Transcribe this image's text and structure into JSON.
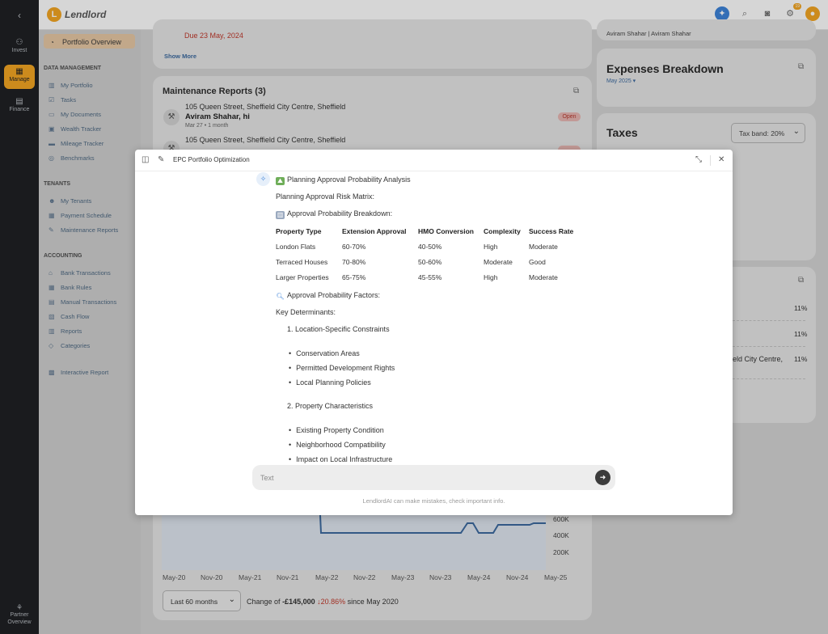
{
  "app": {
    "logo_text": "Lendlord",
    "logo_letter": "L"
  },
  "rail": {
    "items": [
      {
        "label": "Invest",
        "icon": "network-icon"
      },
      {
        "label": "Manage",
        "icon": "grid-icon"
      },
      {
        "label": "Finance",
        "icon": "document-icon"
      }
    ],
    "bottom_label_1": "Partner",
    "bottom_label_2": "Overview"
  },
  "topbar": {
    "notification_count": "19"
  },
  "sidebar": {
    "active_item": "Portfolio Overview",
    "sections": {
      "data_management": "DATA MANAGEMENT",
      "tenants": "TENANTS",
      "accounting": "ACCOUNTING"
    },
    "items": [
      "My Portfolio",
      "Tasks",
      "My Documents",
      "Wealth Tracker",
      "Mileage Tracker",
      "Benchmarks",
      "My Tenants",
      "Payment Schedule",
      "Maintenance Reports",
      "Bank Transactions",
      "Bank Rules",
      "Manual Transactions",
      "Cash Flow",
      "Reports",
      "Categories",
      "Interactive Report"
    ]
  },
  "dashboard": {
    "due_text": "Due 23 May, 2024",
    "show_more": "Show More",
    "maintenance_title": "Maintenance Reports (3)",
    "reports": [
      {
        "address": "105 Queen Street, Sheffield City Centre, Sheffield",
        "name": "Aviram Shahar, hi",
        "meta": "Mar 27 • 1 month",
        "status": "Open"
      },
      {
        "address": "105 Queen Street, Sheffield City Centre, Sheffield"
      }
    ],
    "aviram_line": "Aviram Shahar | Aviram Shahar",
    "expenses_title": "Expenses Breakdown",
    "expenses_date": "May 2025 ▾",
    "taxes_title": "Taxes",
    "tax_band": "Tax band: 20%",
    "percentages": [
      "11%",
      "11%",
      "11%"
    ],
    "right_fragment": "eld City Centre,",
    "chart_y_ticks": [
      "600K",
      "400K",
      "200K"
    ],
    "chart_x_ticks": [
      "May-20",
      "Nov-20",
      "May-21",
      "Nov-21",
      "May-22",
      "Nov-22",
      "May-23",
      "Nov-23",
      "May-24",
      "Nov-24",
      "May-25"
    ],
    "range": "Last 60 months",
    "change_prefix": "Change of",
    "change_value": "-£145,000",
    "change_pct": "↓20.86%",
    "change_suffix": "since May 2020"
  },
  "modal": {
    "title": "EPC Portfolio Optimization",
    "heading": "Planning Approval Probability Analysis",
    "subheading": "Planning Approval Risk Matrix:",
    "breakdown_label": "Approval Probability Breakdown:",
    "table": {
      "headers": [
        "Property Type",
        "Extension Approval",
        "HMO Conversion",
        "Complexity",
        "Success Rate"
      ],
      "rows": [
        [
          "London Flats",
          "60-70%",
          "40-50%",
          "High",
          "Moderate"
        ],
        [
          "Terraced Houses",
          "70-80%",
          "50-60%",
          "Moderate",
          "Good"
        ],
        [
          "Larger Properties",
          "65-75%",
          "45-55%",
          "High",
          "Moderate"
        ]
      ]
    },
    "factors_label": "Approval Probability Factors:",
    "key_determinants": "Key Determinants:",
    "list1_title": "1. Location-Specific Constraints",
    "list1_items": [
      "Conservation Areas",
      "Permitted Development Rights",
      "Local Planning Policies"
    ],
    "list2_title": "2. Property Characteristics",
    "list2_items": [
      "Existing Property Condition",
      "Neighborhood Compatibility",
      "Impact on Local Infrastructure"
    ],
    "input_placeholder": "Text",
    "disclaimer": "LendlordAI can make mistakes, check important info."
  }
}
